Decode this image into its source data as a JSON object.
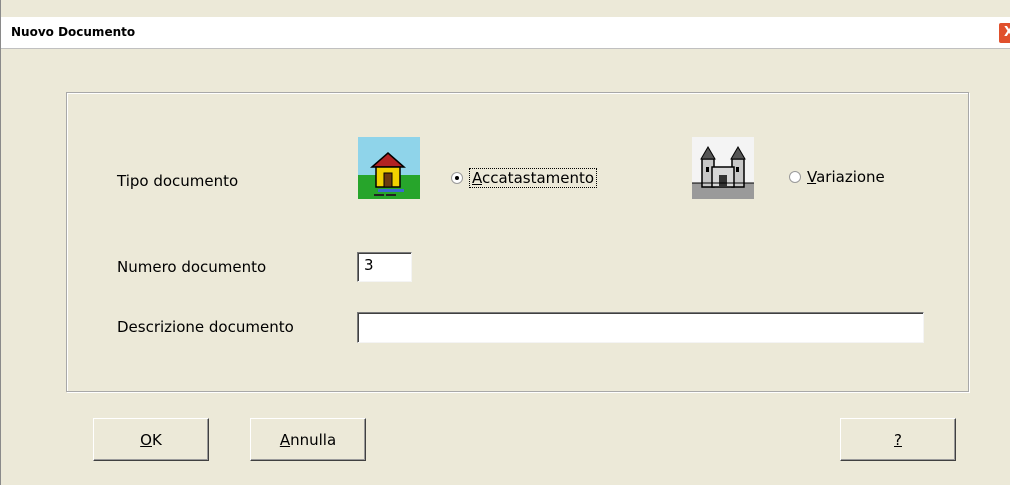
{
  "window": {
    "title": "Nuovo Documento",
    "close_symbol": "X"
  },
  "form": {
    "tipo_label": "Tipo documento",
    "radio_accatastamento": {
      "mnemonic": "A",
      "rest": "ccatastamento",
      "checked": true,
      "icon": "house-icon"
    },
    "radio_variazione": {
      "mnemonic": "V",
      "rest": "ariazione",
      "checked": false,
      "icon": "castle-icon"
    },
    "numero_label": "Numero documento",
    "numero_value": "3",
    "descrizione_label": "Descrizione documento",
    "descrizione_value": ""
  },
  "buttons": {
    "ok": {
      "mnemonic": "O",
      "rest": "K"
    },
    "annulla": {
      "mnemonic": "A",
      "rest": "nnulla"
    },
    "help": {
      "mnemonic": "?",
      "rest": ""
    }
  }
}
